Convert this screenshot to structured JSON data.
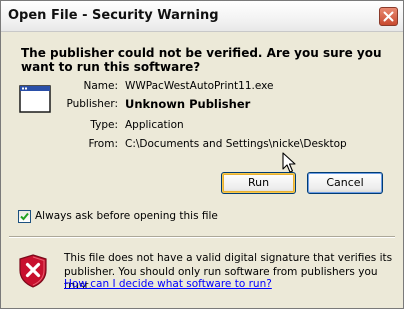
{
  "window": {
    "title": "Open File - Security Warning"
  },
  "dialog": {
    "heading": "The publisher could not be verified.  Are you sure you want to run this software?",
    "fields": [
      {
        "label": "Name:",
        "value": "WWPacWestAutoPrint11.exe"
      },
      {
        "label": "Publisher:",
        "value": "Unknown Publisher"
      },
      {
        "label": "Type:",
        "value": "Application"
      },
      {
        "label": "From:",
        "value": "C:\\Documents and Settings\\nicke\\Desktop"
      }
    ],
    "run_label": "Run",
    "cancel_label": "Cancel",
    "checkbox_label": "Always ask before opening this file",
    "checkbox_checked": true,
    "warning_text": "This file does not have a valid digital signature that verifies its publisher.  You should only run software from publishers you trust.",
    "help_link": "How can I decide what software to run?"
  },
  "icons": {
    "close": "close-icon",
    "file": "application-window-icon",
    "warning": "security-shield-warning-icon",
    "checkmark": "checkmark-icon",
    "cursor": "mouse-pointer-icon"
  },
  "colors": {
    "dialog_bg": "#ece9d8",
    "button_border": "#003c74",
    "link": "#0000ff",
    "shield_red": "#c8102e"
  }
}
